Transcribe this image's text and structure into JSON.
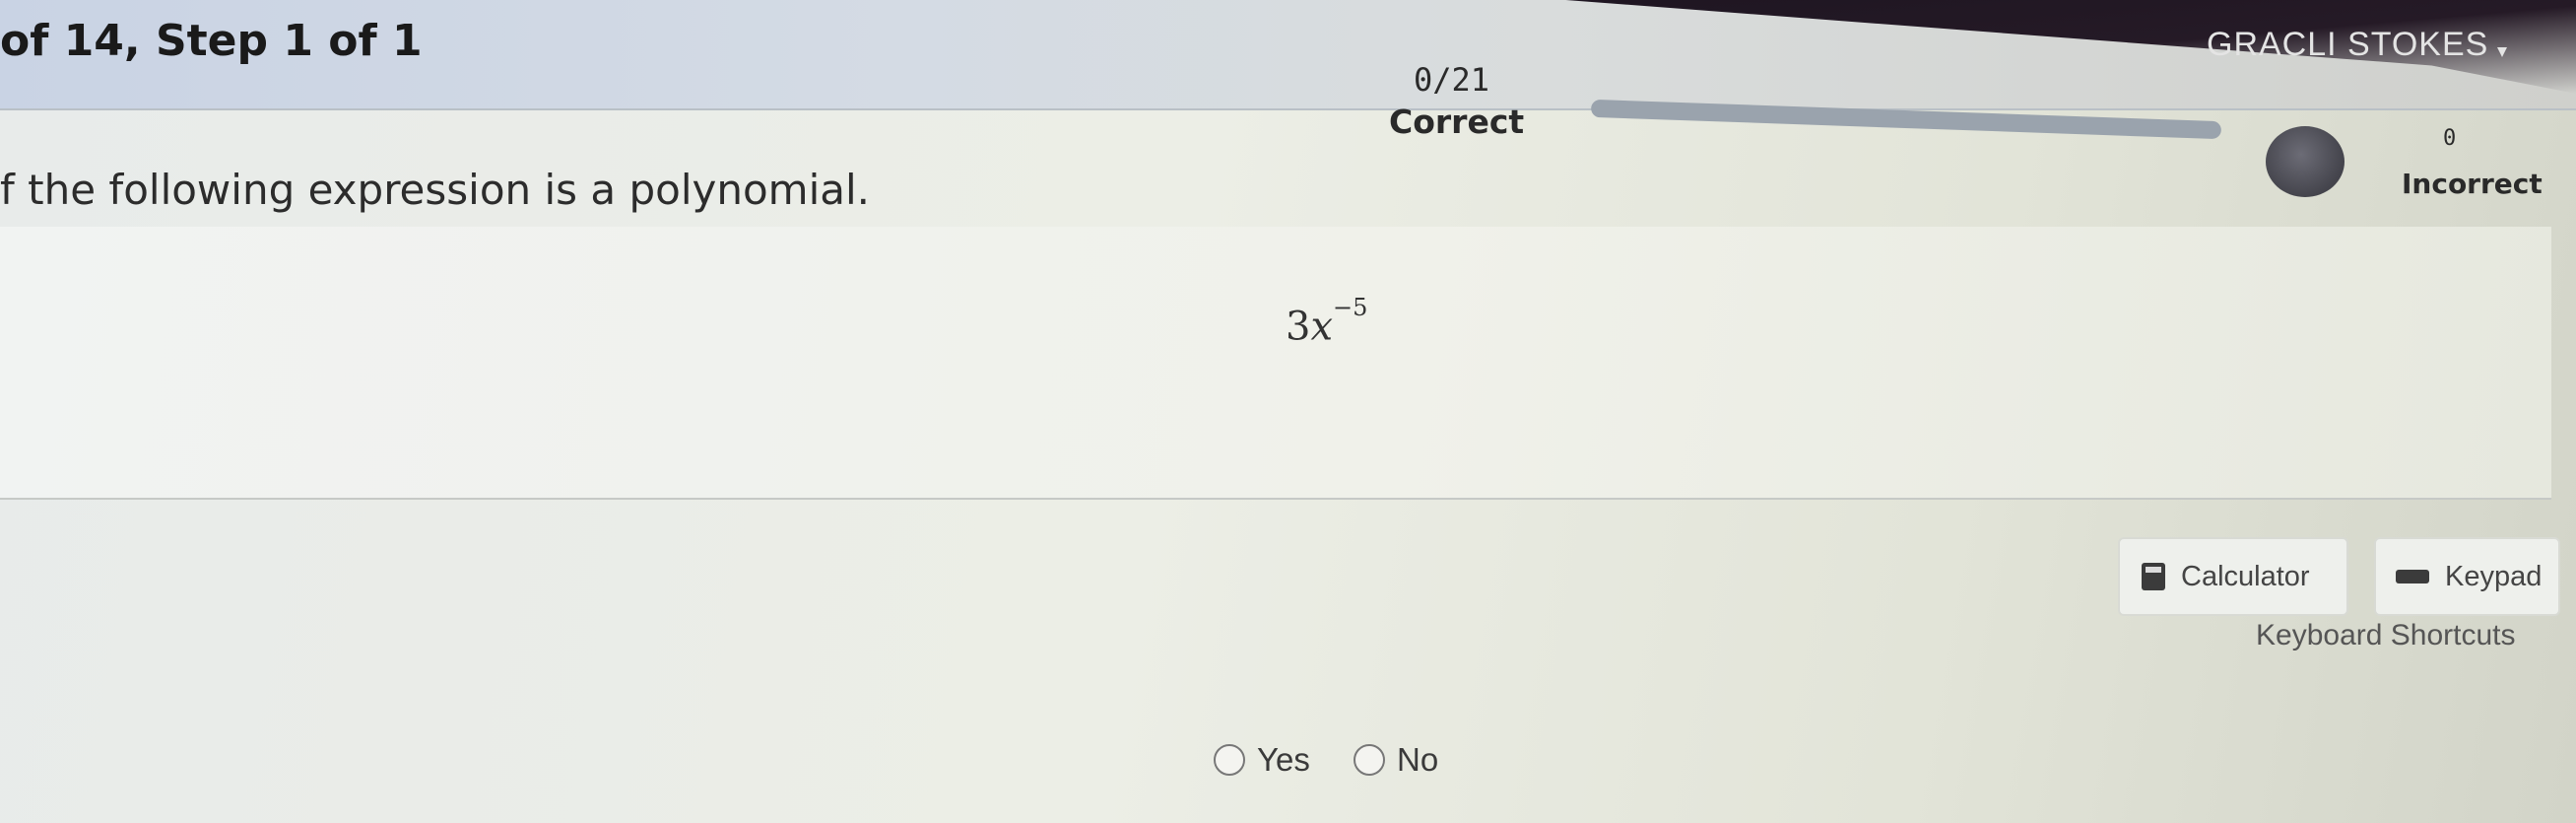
{
  "header": {
    "step_label": "of 14,  Step 1 of 1",
    "user_name": "GRACLI STOKES",
    "correct_count": "0/21",
    "correct_label": "Correct",
    "incorrect_count": "0",
    "incorrect_label": "Incorrect",
    "progress_fraction": 0
  },
  "question": {
    "prompt": "f the following expression is a polynomial.",
    "expression_coefficient": "3",
    "expression_variable": "x",
    "expression_exponent": "−5"
  },
  "tools": {
    "calculator_label": "Calculator",
    "calculator_icon": "calculator-icon",
    "keypad_label": "Keypad",
    "keypad_icon": "keyboard-icon",
    "shortcuts_label": "Keyboard Shortcuts"
  },
  "answers": {
    "options": [
      "Yes",
      "No"
    ]
  },
  "colors": {
    "header_dark": "#1c1420",
    "progress_track": "#9aa3ad"
  }
}
